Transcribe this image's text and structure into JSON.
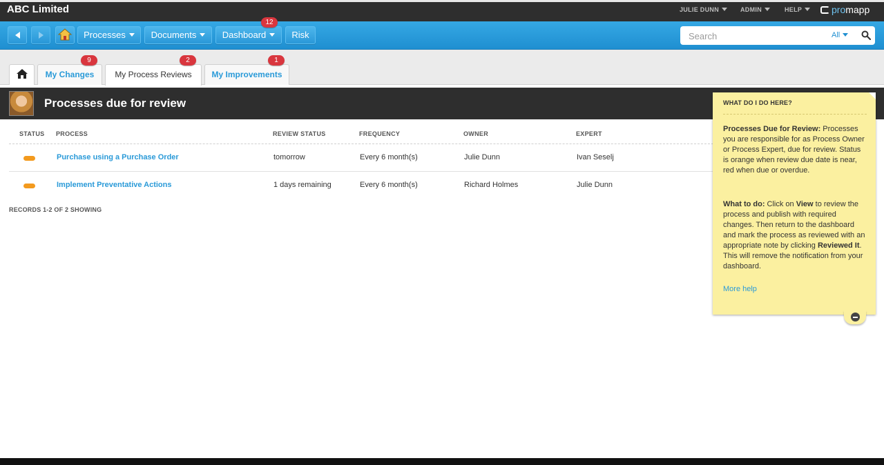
{
  "app": {
    "title": "ABC Limited",
    "logo": {
      "prefix": "pro",
      "suffix": "mapp"
    }
  },
  "user_menu": [
    {
      "label": "JULIE DUNN"
    },
    {
      "label": "ADMIN"
    },
    {
      "label": "HELP"
    }
  ],
  "nav": {
    "processes": "Processes",
    "documents": "Documents",
    "dashboard": "Dashboard",
    "dashboard_badge": "12",
    "risk": "Risk"
  },
  "search": {
    "placeholder": "Search",
    "scope": "All"
  },
  "tabs": [
    {
      "label": "My Changes",
      "badge": "9"
    },
    {
      "label": "My Process Reviews",
      "badge": "2"
    },
    {
      "label": "My Improvements",
      "badge": "1"
    }
  ],
  "page": {
    "title": "Processes due for review"
  },
  "table": {
    "columns": [
      "STATUS",
      "PROCESS",
      "REVIEW STATUS",
      "FREQUENCY",
      "OWNER",
      "EXPERT"
    ],
    "rows": [
      {
        "process": "Purchase using a Purchase Order",
        "review_status": "tomorrow",
        "frequency": "Every 6 month(s)",
        "owner": "Julie Dunn",
        "expert": "Ivan Seselj"
      },
      {
        "process": "Implement Preventative Actions",
        "review_status": "1 days remaining",
        "frequency": "Every 6 month(s)",
        "owner": "Richard Holmes",
        "expert": "Julie Dunn"
      }
    ],
    "records": "RECORDS 1-2 OF 2 SHOWING"
  },
  "help": {
    "title": "WHAT DO I DO HERE?",
    "p1_bold": "Processes Due for Review:",
    "p1_text": " Processes you are responsible for as Process Owner or Process Expert, due for review. Status is orange when review due date is near, red when due or overdue.",
    "p2_bold": "What to do:",
    "p2_text_a": " Click on ",
    "p2_view": "View",
    "p2_text_b": " to review the process and publish with required changes. Then return to the dashboard and mark the process as reviewed with an appropriate note by clicking ",
    "p2_reviewed": "Reviewed It",
    "p2_text_c": ". This will remove the notification from your dashboard.",
    "more": "More help"
  },
  "colors": {
    "nav_blue": "#1f8fd1",
    "link_blue": "#2a9ad8",
    "status_orange": "#f39a1e",
    "badge_red": "#d9363e",
    "help_yellow": "#fbf0a0"
  }
}
